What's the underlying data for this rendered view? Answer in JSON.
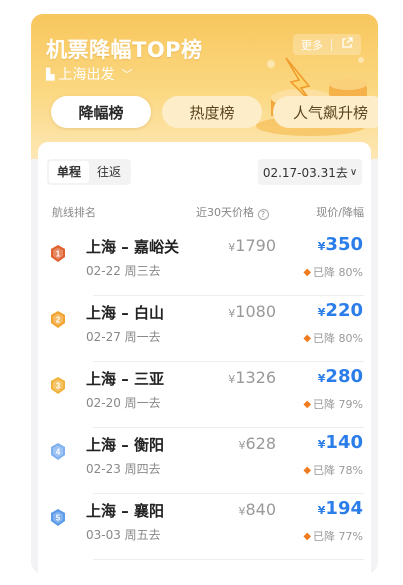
{
  "hero": {
    "title": "机票降幅TOP榜",
    "city": "上海出发",
    "more_label": "更多",
    "share_icon": "share-icon"
  },
  "tabs": [
    {
      "label": "降幅榜",
      "active": true
    },
    {
      "label": "热度榜",
      "active": false
    },
    {
      "label": "人气飙升榜",
      "active": false
    }
  ],
  "trip_toggle": {
    "one_way": "单程",
    "round_trip": "往返"
  },
  "date_range": "02.17-03.31去",
  "columns": {
    "route": "航线排名",
    "avg": "近30天价格",
    "now": "现价/降幅"
  },
  "currency": "¥",
  "rows": [
    {
      "rank": "1",
      "route": "上海 – 嘉峪关",
      "date": "02-22 周三去",
      "orig": "1790",
      "now": "350",
      "drop": "已降 80%",
      "medal_color": "#e0602e"
    },
    {
      "rank": "2",
      "route": "上海 – 白山",
      "date": "02-27 周一去",
      "orig": "1080",
      "now": "220",
      "drop": "已降 80%",
      "medal_color": "#f2a32e"
    },
    {
      "rank": "3",
      "route": "上海 – 三亚",
      "date": "02-20 周一去",
      "orig": "1326",
      "now": "280",
      "drop": "已降 79%",
      "medal_color": "#f2b23a"
    },
    {
      "rank": "4",
      "route": "上海 – 衡阳",
      "date": "02-23 周四去",
      "orig": "628",
      "now": "140",
      "drop": "已降 78%",
      "medal_color": "#7fb0f0"
    },
    {
      "rank": "5",
      "route": "上海 – 襄阳",
      "date": "03-03 周五去",
      "orig": "840",
      "now": "194",
      "drop": "已降 77%",
      "medal_color": "#5a9ae8"
    }
  ]
}
